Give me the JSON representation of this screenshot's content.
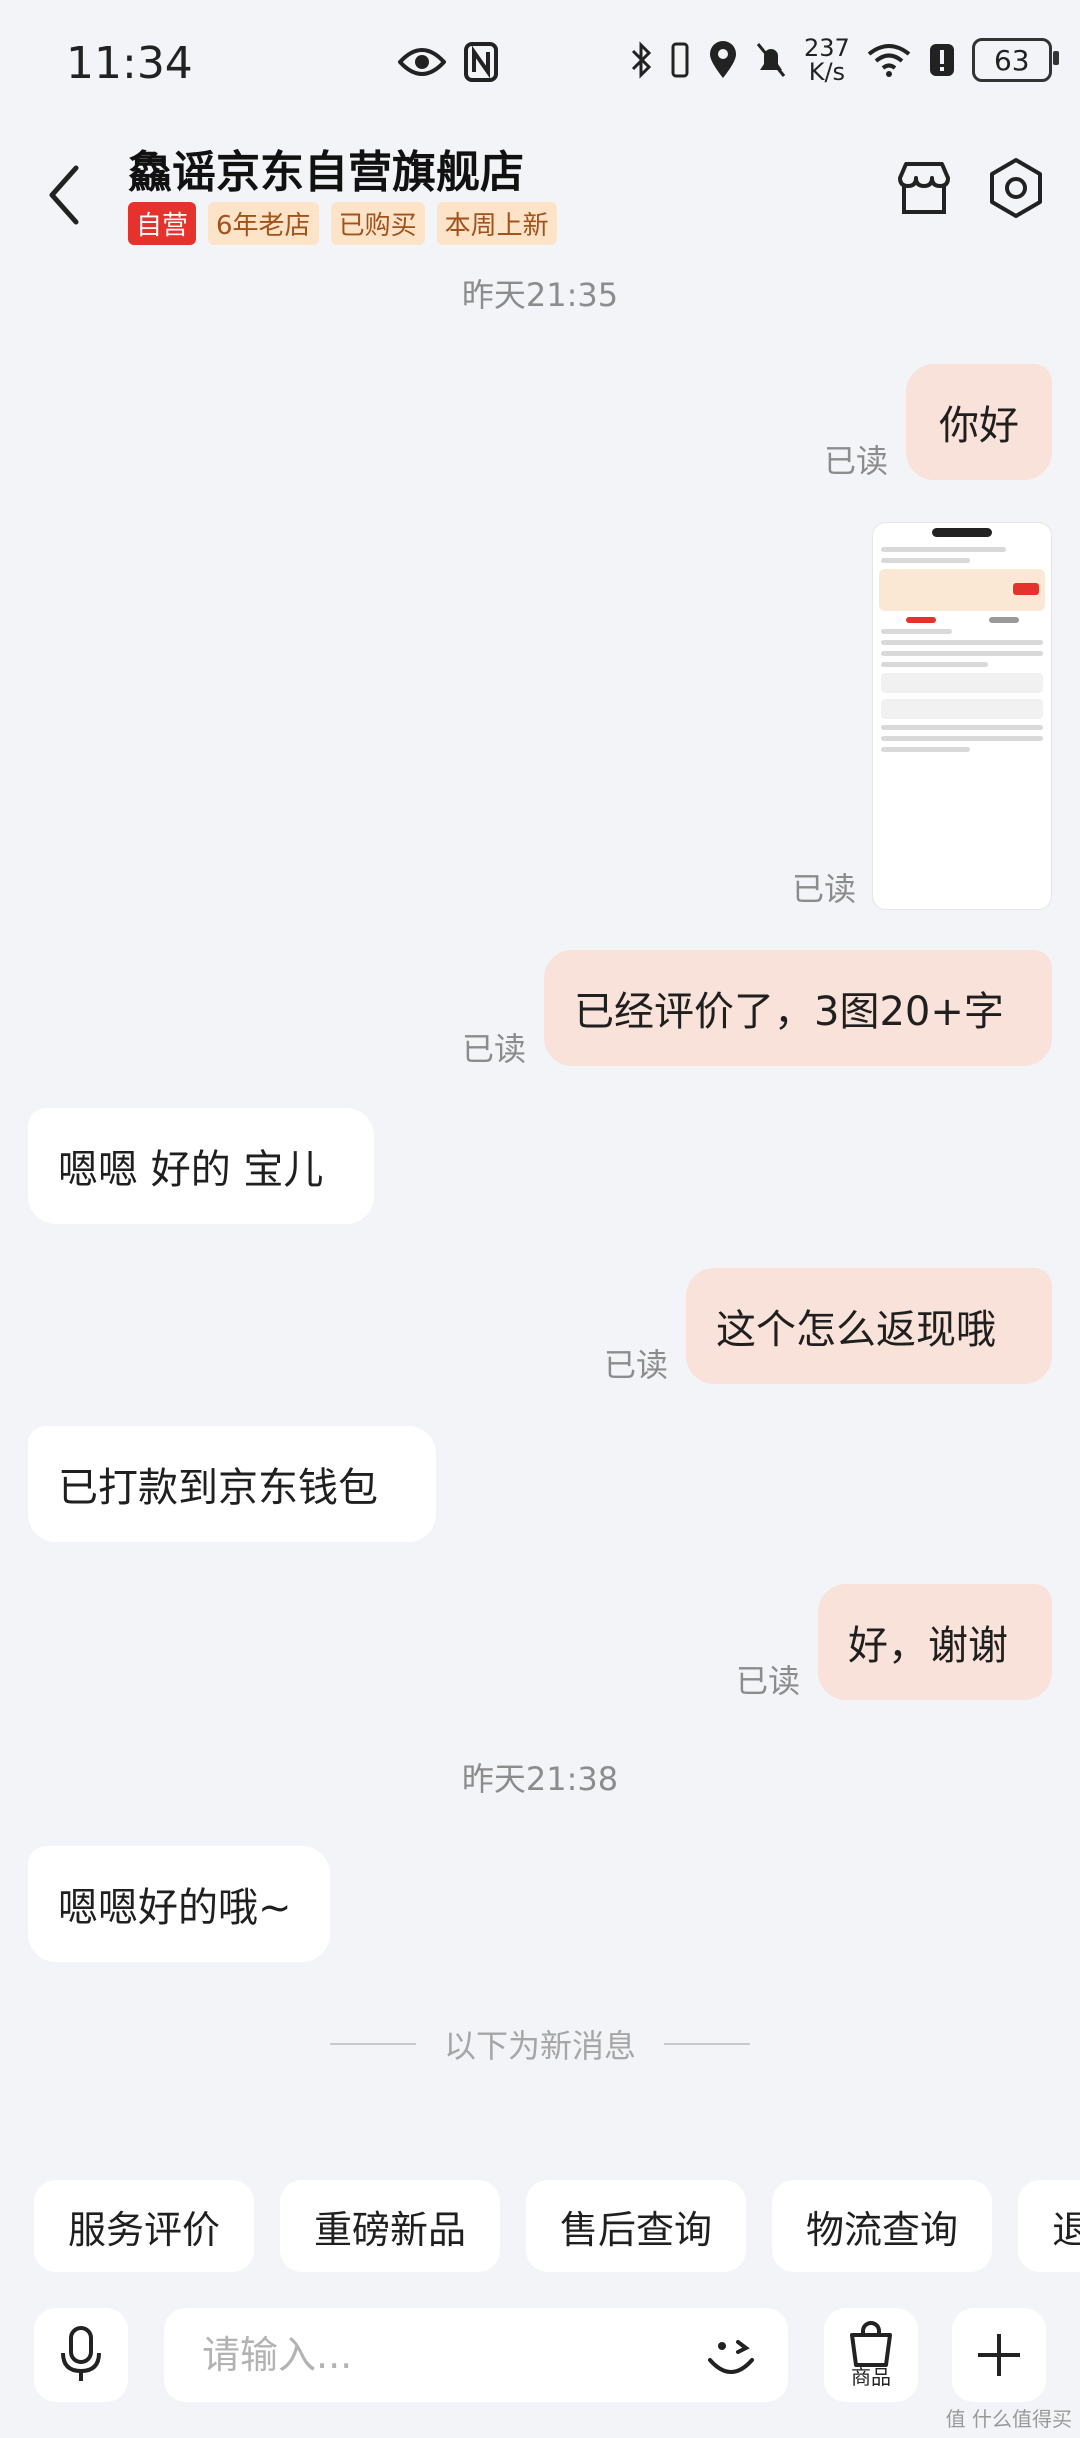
{
  "status_bar": {
    "time": "11:34",
    "net_speed_value": "237",
    "net_speed_unit": "K/s",
    "battery": "63",
    "icons": [
      "eye-icon",
      "nfc-icon",
      "bluetooth-icon",
      "vibrate-icon",
      "location-icon",
      "mute-icon",
      "wifi-icon",
      "alert-icon",
      "battery-icon"
    ]
  },
  "header": {
    "title": "鱻谣京东自营旗舰店",
    "tags": [
      "自营",
      "6年老店",
      "已购买",
      "本周上新"
    ],
    "accent": "#e6322d"
  },
  "chat": {
    "timestamp_1": "昨天21:35",
    "read_label": "已读",
    "msg_hello": "你好",
    "msg_reviewed": "已经评价了，3图20+字",
    "msg_ok_dear": "嗯嗯 好的 宝儿",
    "msg_how_cashback": "这个怎么返现哦",
    "msg_paid": "已打款到京东钱包",
    "msg_thanks": "好，谢谢",
    "timestamp_2": "昨天21:38",
    "msg_ok": "嗯嗯好的哦~",
    "new_messages_divider": "以下为新消息"
  },
  "quick_replies": [
    "服务评价",
    "重磅新品",
    "售后查询",
    "物流查询",
    "退"
  ],
  "composer": {
    "placeholder": "请输入...",
    "goods_label": "商品"
  },
  "watermark": "值 什么值得买"
}
